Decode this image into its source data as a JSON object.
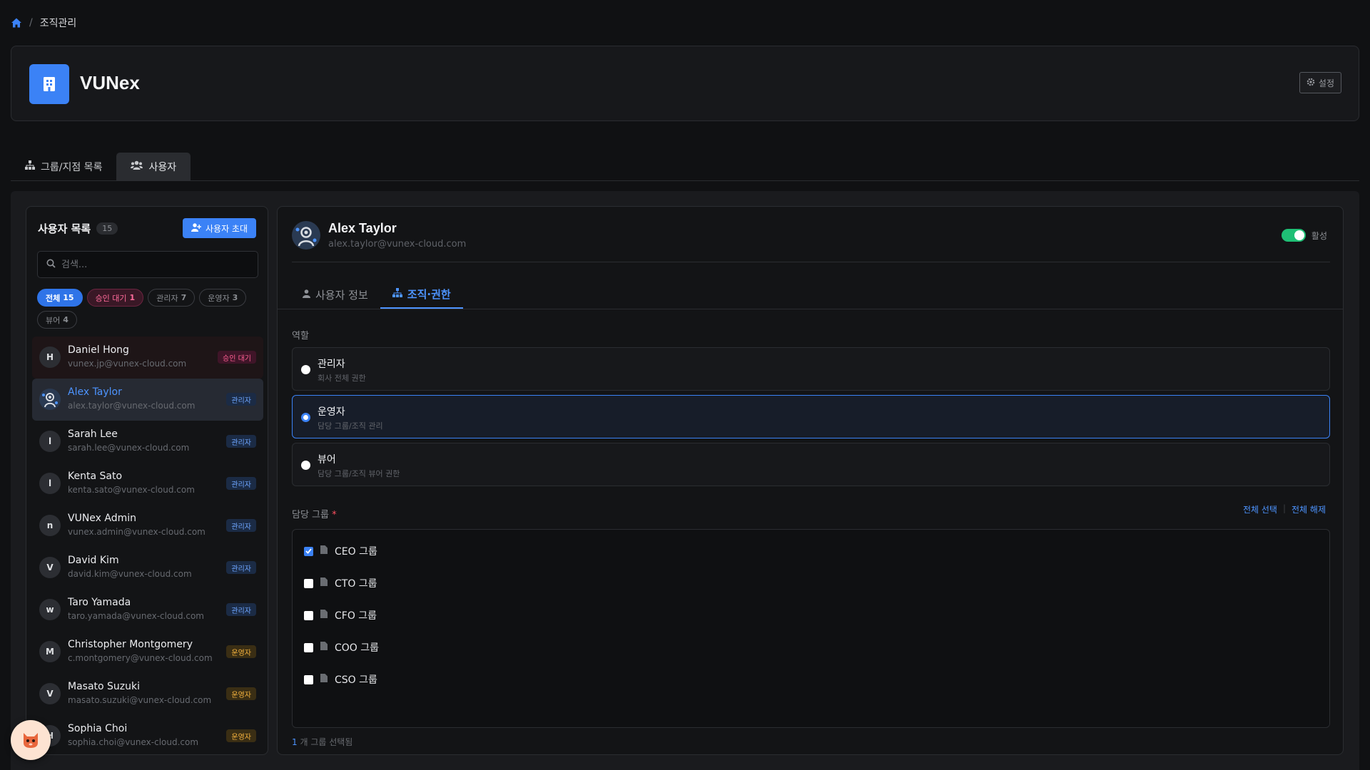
{
  "breadcrumb": {
    "current": "조직관리"
  },
  "org": {
    "name": "VUNex",
    "settings_label": "설정"
  },
  "main_tabs": [
    {
      "label": "그룹/지점 목록"
    },
    {
      "label": "사용자"
    }
  ],
  "user_panel": {
    "title": "사용자 목록",
    "count": "15",
    "invite_label": "사용자 초대",
    "search_placeholder": "검색...",
    "filters": [
      {
        "label": "전체",
        "count": "15"
      },
      {
        "label": "승인 대기",
        "count": "1"
      },
      {
        "label": "관리자",
        "count": "7"
      },
      {
        "label": "운영자",
        "count": "3"
      },
      {
        "label": "뷰어",
        "count": "4"
      }
    ],
    "users": [
      {
        "initial": "H",
        "name": "Daniel Hong",
        "email": "vunex.jp@vunex-cloud.com",
        "role": "승인 대기"
      },
      {
        "initial": "",
        "name": "Alex Taylor",
        "email": "alex.taylor@vunex-cloud.com",
        "role": "관리자"
      },
      {
        "initial": "l",
        "name": "Sarah Lee",
        "email": "sarah.lee@vunex-cloud.com",
        "role": "관리자"
      },
      {
        "initial": "l",
        "name": "Kenta Sato",
        "email": "kenta.sato@vunex-cloud.com",
        "role": "관리자"
      },
      {
        "initial": "n",
        "name": "VUNex Admin",
        "email": "vunex.admin@vunex-cloud.com",
        "role": "관리자"
      },
      {
        "initial": "V",
        "name": "David Kim",
        "email": "david.kim@vunex-cloud.com",
        "role": "관리자"
      },
      {
        "initial": "w",
        "name": "Taro Yamada",
        "email": "taro.yamada@vunex-cloud.com",
        "role": "관리자"
      },
      {
        "initial": "M",
        "name": "Christopher Montgomery",
        "email": "c.montgomery@vunex-cloud.com",
        "role": "운영자"
      },
      {
        "initial": "V",
        "name": "Masato Suzuki",
        "email": "masato.suzuki@vunex-cloud.com",
        "role": "운영자"
      },
      {
        "initial": "H",
        "name": "Sophia Choi",
        "email": "sophia.choi@vunex-cloud.com",
        "role": "운영자"
      }
    ]
  },
  "detail": {
    "name": "Alex Taylor",
    "email": "alex.taylor@vunex-cloud.com",
    "status_label": "활성",
    "tabs": [
      {
        "label": "사용자 정보"
      },
      {
        "label": "조직·권한"
      }
    ],
    "role_section_label": "역할",
    "roles": [
      {
        "title": "관리자",
        "desc": "회사 전체 권한",
        "selected": false
      },
      {
        "title": "운영자",
        "desc": "담당 그룹/조직 관리",
        "selected": true
      },
      {
        "title": "뷰어",
        "desc": "담당 그룹/조직 뷰어 권한",
        "selected": false
      }
    ],
    "group_section_label": "담당 그룹",
    "required_mark": "*",
    "select_all": "전체 선택",
    "deselect_all": "전체 해제",
    "groups": [
      {
        "label": "CEO 그룹",
        "checked": true
      },
      {
        "label": "CTO 그룹",
        "checked": false
      },
      {
        "label": "CFO 그룹",
        "checked": false
      },
      {
        "label": "COO 그룹",
        "checked": false
      },
      {
        "label": "CSO 그룹",
        "checked": false
      }
    ],
    "selected_count": "1",
    "selected_suffix": "개 그룹 선택됨"
  },
  "colors": {
    "accent": "#3b82f6",
    "background": "#101113",
    "toggle_on": "#1fbf75",
    "admin_badge": "#6ea6ff",
    "operator_badge": "#f4b23e",
    "pending_badge": "#ff5f93"
  }
}
